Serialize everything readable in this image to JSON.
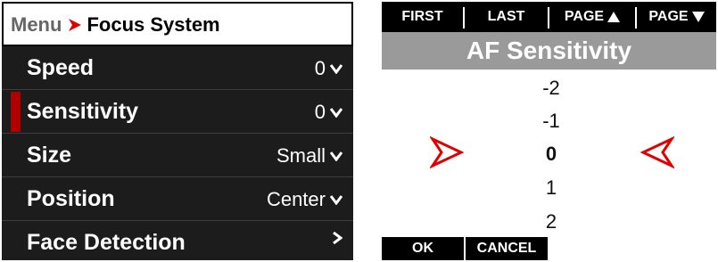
{
  "left_panel": {
    "breadcrumb": {
      "root": "Menu",
      "current": "Focus System"
    },
    "items": [
      {
        "label": "Speed",
        "value": "0",
        "indicator": "chevron-down-icon"
      },
      {
        "label": "Sensitivity",
        "value": "0",
        "indicator": "chevron-down-icon",
        "selected": true
      },
      {
        "label": "Size",
        "value": "Small",
        "indicator": "chevron-down-icon"
      },
      {
        "label": "Position",
        "value": "Center",
        "indicator": "chevron-down-icon"
      },
      {
        "label": "Face Detection",
        "value": "",
        "indicator": "chevron-right-icon"
      }
    ]
  },
  "right_panel": {
    "nav": {
      "first": "FIRST",
      "last": "LAST",
      "page_up": "PAGE",
      "page_down": "PAGE"
    },
    "title": "AF Sensitivity",
    "options": [
      "-2",
      "-1",
      "0",
      "1",
      "2"
    ],
    "selected_value": "0",
    "buttons": {
      "ok": "OK",
      "cancel": "CANCEL"
    }
  },
  "colors": {
    "menu_background": "#1c1c1c",
    "selection_marker": "#b20000",
    "breadcrumb_arrow": "#e00000",
    "title_bar": "#9a9a9a",
    "picker_arrows": "#e00000"
  }
}
